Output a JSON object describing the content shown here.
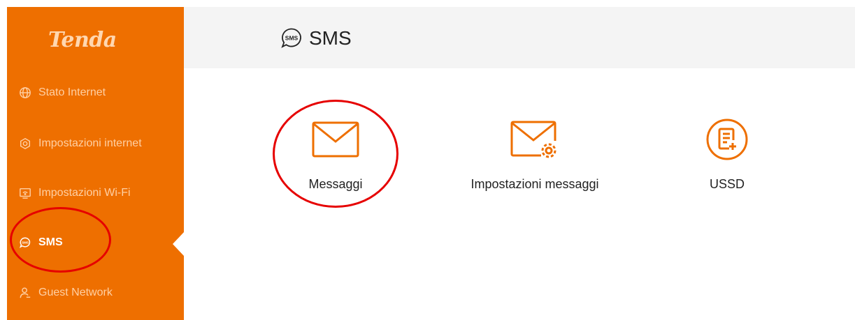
{
  "brand": {
    "logo_text": "Tenda",
    "accent": "#ee6f00"
  },
  "sidebar": {
    "items": [
      {
        "label": "Stato Internet",
        "icon": "globe-icon",
        "active": false
      },
      {
        "label": "Impostazioni internet",
        "icon": "settings-hexagon-icon",
        "active": false
      },
      {
        "label": "Impostazioni Wi-Fi",
        "icon": "wifi-monitor-icon",
        "active": false
      },
      {
        "label": "SMS",
        "icon": "sms-bubble-icon",
        "active": true
      },
      {
        "label": "Guest Network",
        "icon": "guest-user-icon",
        "active": false
      }
    ]
  },
  "header": {
    "title": "SMS",
    "icon_text": "SMS"
  },
  "tiles": [
    {
      "label": "Messaggi",
      "icon": "envelope-icon"
    },
    {
      "label": "Impostazioni messaggi",
      "icon": "envelope-gear-icon"
    },
    {
      "label": "USSD",
      "icon": "document-plus-icon"
    }
  ],
  "annotation_color": "#e60000"
}
